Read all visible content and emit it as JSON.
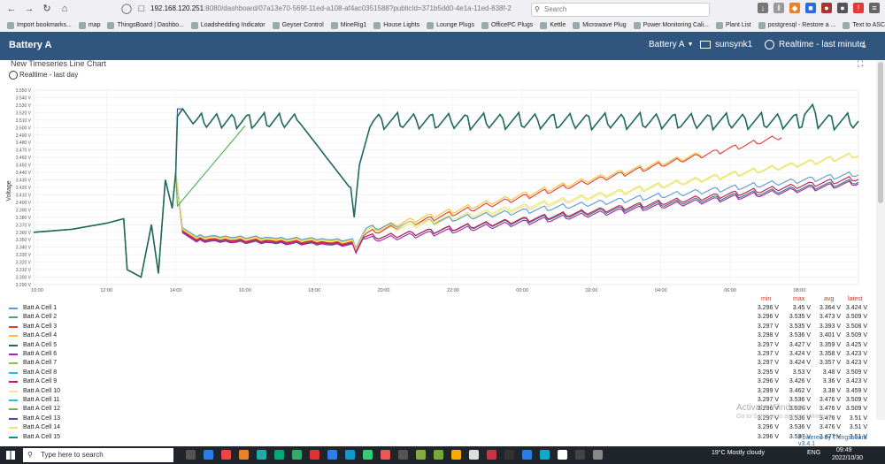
{
  "browser": {
    "url_host": "192.168.120.251",
    "url_rest": ":8080/dashboard/07a13e70-569f-11ed-a108-af4ac0351588?publicId=371b5dd0-4e1a-11ed-838f-2",
    "search_placeholder": "Search",
    "bookmarks": [
      "Import bookmarks...",
      "map",
      "ThingsBoard | Dashbo...",
      "Loadshedding Indicator",
      "Geyser Control",
      "MineRig1",
      "House Lights",
      "Lounge Plugs",
      "OfficePC Plugs",
      "Kettle",
      "Microwave Plug",
      "Power Monitoring Cali...",
      "Plant List",
      "postgresql - Restore a ...",
      "Text to ASCII Art Gene..."
    ]
  },
  "header": {
    "title": "Battery A",
    "entity_select": "Battery A",
    "device": "sunsynk1",
    "timewindow": "Realtime - last minute"
  },
  "widget": {
    "title": "New Timeseries Line Chart",
    "subtitle": "Realtime - last day"
  },
  "legend": {
    "headers": {
      "min": "min",
      "max": "max",
      "avg": "avg",
      "latest": "latest"
    },
    "rows": [
      {
        "name": "Batt A Cell 1",
        "color": "#5b9bd5",
        "min": "3.296 V",
        "max": "3.45 V",
        "avg": "3.364 V",
        "latest": "3.424 V"
      },
      {
        "name": "Batt A Cell 2",
        "color": "#4caf50",
        "min": "3.296 V",
        "max": "3.535 V",
        "avg": "3.473 V",
        "latest": "3.509 V"
      },
      {
        "name": "Batt A Cell 3",
        "color": "#e53935",
        "min": "3.297 V",
        "max": "3.535 V",
        "avg": "3.393 V",
        "latest": "3.508 V"
      },
      {
        "name": "Batt A Cell 4",
        "color": "#f4c430",
        "min": "3.298 V",
        "max": "3.536 V",
        "avg": "3.401 V",
        "latest": "3.509 V"
      },
      {
        "name": "Batt A Cell 5",
        "color": "#1e6b5b",
        "min": "3.297 V",
        "max": "3.427 V",
        "avg": "3.359 V",
        "latest": "3.425 V"
      },
      {
        "name": "Batt A Cell 6",
        "color": "#9c27b0",
        "min": "3.297 V",
        "max": "3.424 V",
        "avg": "3.358 V",
        "latest": "3.423 V"
      },
      {
        "name": "Batt A Cell 7",
        "color": "#8bc34a",
        "min": "3.297 V",
        "max": "3.424 V",
        "avg": "3.357 V",
        "latest": "3.423 V"
      },
      {
        "name": "Batt A Cell 8",
        "color": "#29b6f6",
        "min": "3.295 V",
        "max": "3.53 V",
        "avg": "3.48 V",
        "latest": "3.509 V"
      },
      {
        "name": "Batt A Cell 9",
        "color": "#c2185b",
        "min": "3.296 V",
        "max": "3.426 V",
        "avg": "3.36 V",
        "latest": "3.423 V"
      },
      {
        "name": "Batt A Cell 10",
        "color": "#f0e68c",
        "min": "3.299 V",
        "max": "3.462 V",
        "avg": "3.38 V",
        "latest": "3.459 V"
      },
      {
        "name": "Batt A Cell 11",
        "color": "#26c6da",
        "min": "3.297 V",
        "max": "3.536 V",
        "avg": "3.476 V",
        "latest": "3.509 V"
      },
      {
        "name": "Batt A Cell 12",
        "color": "#7cb342",
        "min": "3.296 V",
        "max": "3.536 V",
        "avg": "3.476 V",
        "latest": "3.509 V"
      },
      {
        "name": "Batt A Cell 13",
        "color": "#3f51b5",
        "min": "3.297 V",
        "max": "3.536 V",
        "avg": "3.476 V",
        "latest": "3.51 V"
      },
      {
        "name": "Batt A Cell 14",
        "color": "#e8e86a",
        "min": "3.296 V",
        "max": "3.536 V",
        "avg": "3.476 V",
        "latest": "3.51 V"
      },
      {
        "name": "Batt A Cell 15",
        "color": "#009688",
        "min": "3.296 V",
        "max": "3.537 V",
        "avg": "3.477 V",
        "latest": "3.51 V"
      }
    ]
  },
  "overlay": {
    "activate_line1": "Activate Windows",
    "activate_line2": "Go to Settings to activate Windows.",
    "powered": "Powered by Thingsboard v3.4.1"
  },
  "taskbar": {
    "search_placeholder": "Type here to search",
    "weather": "19°C  Mostly cloudy",
    "lang": "ENG",
    "time": "09:49",
    "date": "2022/10/30"
  },
  "chart_data": {
    "type": "line",
    "ylabel": "Voltage",
    "ylim": [
      3.29,
      3.55
    ],
    "yticks": [
      "3.290 V",
      "3.300 V",
      "3.310 V",
      "3.320 V",
      "3.330 V",
      "3.340 V",
      "3.350 V",
      "3.360 V",
      "3.370 V",
      "3.380 V",
      "3.390 V",
      "3.400 V",
      "3.410 V",
      "3.420 V",
      "3.430 V",
      "3.440 V",
      "3.450 V",
      "3.460 V",
      "3.470 V",
      "3.480 V",
      "3.490 V",
      "3.500 V",
      "3.510 V",
      "3.520 V",
      "3.530 V",
      "3.540 V",
      "3.550 V"
    ],
    "xlabels": [
      "10:00",
      "12:00",
      "14:00",
      "16:00",
      "18:00",
      "20:00",
      "22:00",
      "00:00",
      "02:00",
      "04:00",
      "06:00",
      "08:00"
    ],
    "xlim_hours": [
      9.9,
      33.7
    ],
    "groups": {
      "high": {
        "cells": [
          2,
          8,
          11,
          12,
          13,
          15
        ],
        "latest": 3.509
      },
      "c3": {
        "cell": 3,
        "latest": 3.508
      },
      "c4": {
        "cell": 4,
        "latest": 3.509
      },
      "c10": {
        "cell": 10,
        "latest": 3.459
      },
      "c14": {
        "cell": 14,
        "latest": 3.51
      },
      "low": {
        "cells": [
          1,
          5,
          6,
          7,
          9
        ],
        "latest": 3.424
      }
    },
    "common_segment": [
      [
        9.9,
        3.36
      ],
      [
        11.0,
        3.364
      ],
      [
        12.0,
        3.372
      ],
      [
        12.5,
        3.378
      ],
      [
        12.6,
        3.31
      ],
      [
        13.0,
        3.3
      ],
      [
        13.3,
        3.37
      ],
      [
        13.5,
        3.305
      ],
      [
        13.7,
        3.43
      ],
      [
        13.9,
        3.392
      ],
      [
        14.0,
        3.44
      ]
    ],
    "grid": true,
    "legend_position": "bottom"
  }
}
